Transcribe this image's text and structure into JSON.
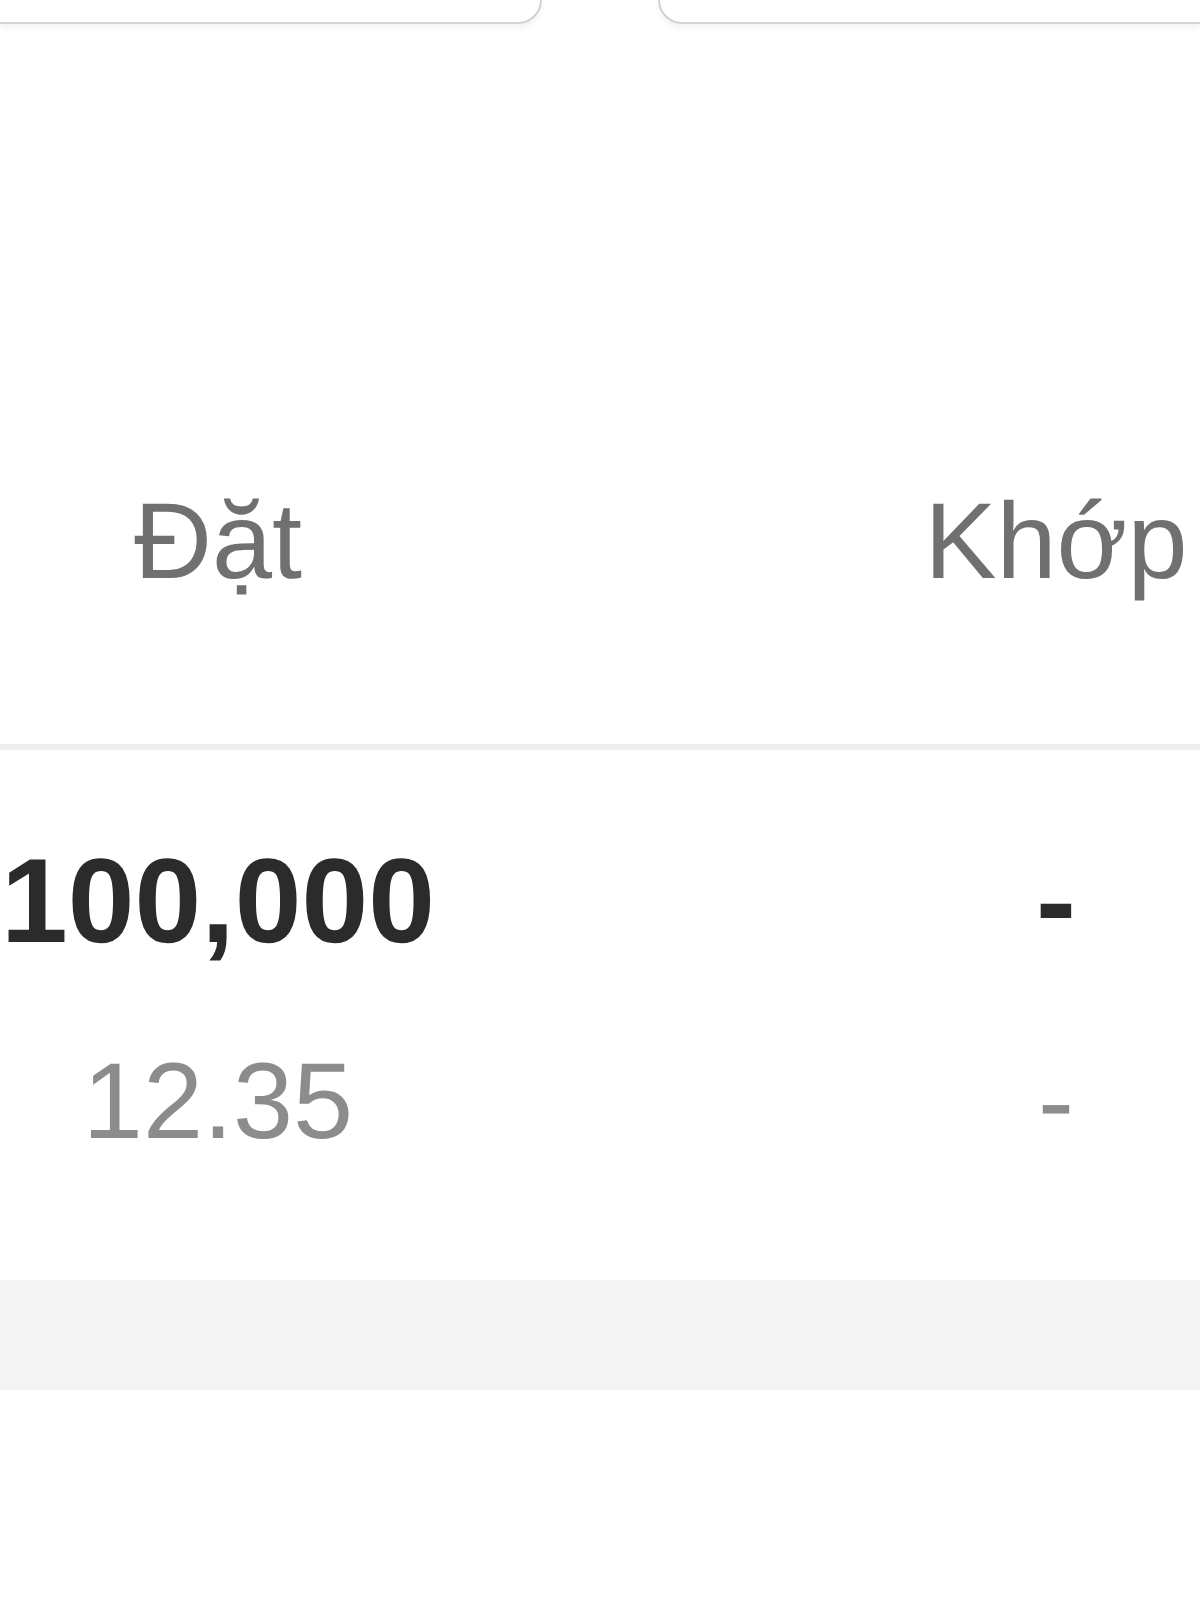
{
  "table": {
    "columns": [
      "Đặt",
      "Khớp"
    ],
    "rows": [
      {
        "kind": "primary",
        "cells": [
          "100,000",
          "-"
        ]
      },
      {
        "kind": "secondary",
        "cells": [
          "12.35",
          "-"
        ]
      }
    ]
  }
}
